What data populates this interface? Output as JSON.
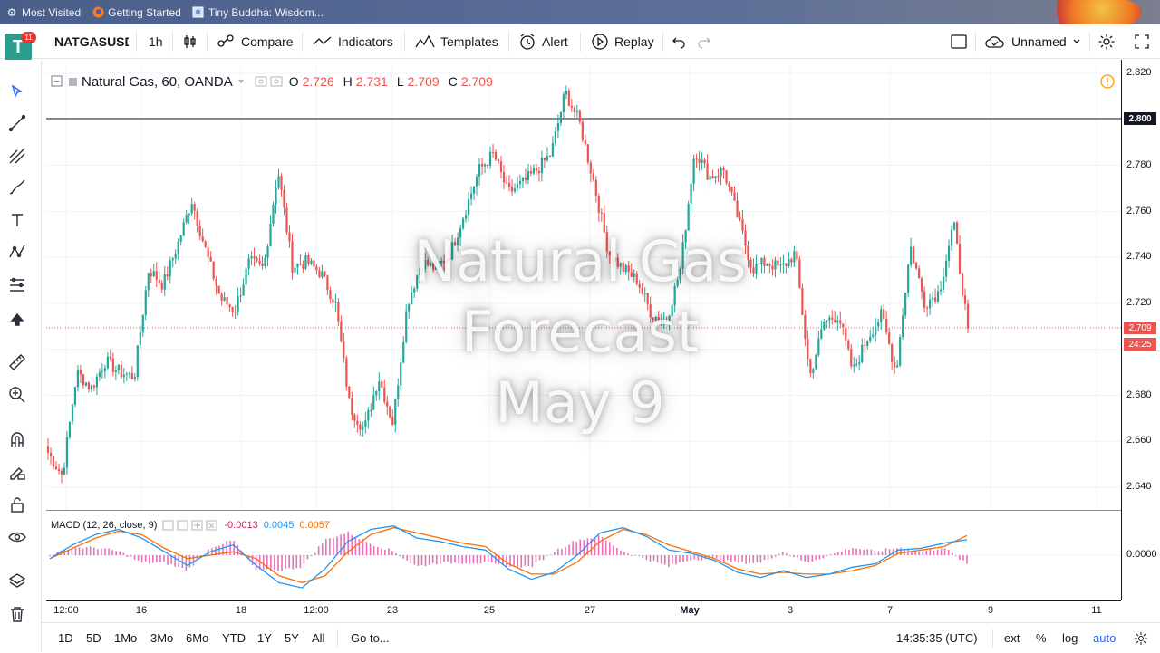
{
  "bookmarks": [
    {
      "icon": "gear-icon",
      "label": "Most Visited"
    },
    {
      "icon": "firefox-icon",
      "label": "Getting Started"
    },
    {
      "icon": "page-icon",
      "label": "Tiny Buddha: Wisdom..."
    }
  ],
  "toolbar": {
    "notification_count": "11",
    "symbol": "NATGASUSD",
    "interval": "1h",
    "compare_label": "Compare",
    "indicators_label": "Indicators",
    "templates_label": "Templates",
    "alert_label": "Alert",
    "replay_label": "Replay",
    "layout_name": "Unnamed"
  },
  "legend": {
    "title": "Natural Gas, 60, OANDA",
    "o_key": "O",
    "o_val": "2.726",
    "h_key": "H",
    "h_val": "2.731",
    "l_key": "L",
    "l_val": "2.709",
    "c_key": "C",
    "c_val": "2.709"
  },
  "watermark": {
    "line1": "Natural Gas",
    "line2": "Forecast",
    "line3": "May 9"
  },
  "macd": {
    "label": "MACD (12, 26, close, 9)",
    "hist": "-0.0013",
    "macd": "0.0045",
    "signal": "0.0057",
    "zero_label": "0.0000"
  },
  "price_axis": {
    "ticks": [
      "2.820",
      "2.780",
      "2.760",
      "2.740",
      "2.720",
      "2.680",
      "2.660",
      "2.640"
    ],
    "line_label": "2.800",
    "last_price": "2.709",
    "countdown": "24:25"
  },
  "time_axis": [
    "12:00",
    "16",
    "18",
    "12:00",
    "23",
    "25",
    "27",
    "May",
    "3",
    "7",
    "9",
    "11"
  ],
  "bottom": {
    "ranges": [
      "1D",
      "5D",
      "1Mo",
      "3Mo",
      "6Mo",
      "YTD",
      "1Y",
      "5Y",
      "All"
    ],
    "goto": "Go to...",
    "clock": "14:35:35 (UTC)",
    "ext": "ext",
    "pct": "%",
    "log": "log",
    "auto": "auto"
  },
  "colors": {
    "up": "#26a69a",
    "down": "#ef5350",
    "macd_line": "#2196f3",
    "signal_line": "#ff6d00",
    "histogram": "#e040a0",
    "accent": "#2962ff"
  },
  "chart_data": {
    "type": "candlestick",
    "instrument": "Natural Gas, 60, OANDA",
    "ylim": [
      2.63,
      2.825
    ],
    "horizontal_line": 2.8,
    "last_price": 2.709,
    "x": [
      "12:00",
      "16",
      "18",
      "12:00",
      "23",
      "25",
      "27",
      "May",
      "3",
      "7",
      "9",
      "11"
    ],
    "close_path": [
      2.655,
      2.645,
      2.69,
      2.683,
      2.695,
      2.69,
      2.688,
      2.735,
      2.728,
      2.745,
      2.765,
      2.742,
      2.722,
      2.717,
      2.738,
      2.735,
      2.778,
      2.736,
      2.738,
      2.733,
      2.72,
      2.675,
      2.665,
      2.688,
      2.668,
      2.72,
      2.738,
      2.735,
      2.742,
      2.76,
      2.778,
      2.785,
      2.768,
      2.772,
      2.778,
      2.785,
      2.812,
      2.798,
      2.772,
      2.742,
      2.735,
      2.73,
      2.715,
      2.712,
      2.735,
      2.787,
      2.775,
      2.778,
      2.757,
      2.735,
      2.738,
      2.735,
      2.742,
      2.688,
      2.712,
      2.715,
      2.69,
      2.705,
      2.715,
      2.69,
      2.745,
      2.72,
      2.725,
      2.755,
      2.709
    ],
    "macd": [
      -0.001,
      0.003,
      0.006,
      0.0075,
      0.005,
      0.001,
      -0.003,
      0.001,
      0.003,
      -0.003,
      -0.008,
      -0.0095,
      -0.004,
      0.004,
      0.0075,
      0.0085,
      0.005,
      0.004,
      0.0025,
      0.0015,
      -0.004,
      -0.007,
      -0.005,
      0.0,
      0.0065,
      0.008,
      0.0055,
      0.0015,
      0.0005,
      -0.0015,
      -0.005,
      -0.0065,
      -0.0045,
      -0.0065,
      -0.0055,
      -0.0035,
      -0.0025,
      0.0015,
      0.002,
      0.0035,
      0.0045
    ],
    "signal": [
      -0.001,
      0.002,
      0.005,
      0.007,
      0.006,
      0.002,
      -0.001,
      0.0,
      0.001,
      -0.001,
      -0.006,
      -0.008,
      -0.006,
      0.001,
      0.006,
      0.008,
      0.0065,
      0.005,
      0.0035,
      0.0025,
      -0.0025,
      -0.0055,
      -0.0055,
      -0.002,
      0.004,
      0.0075,
      0.006,
      0.003,
      0.001,
      -0.001,
      -0.004,
      -0.0055,
      -0.005,
      -0.0055,
      -0.0055,
      -0.0045,
      -0.003,
      0.0005,
      0.0015,
      0.0025,
      0.0057
    ]
  }
}
